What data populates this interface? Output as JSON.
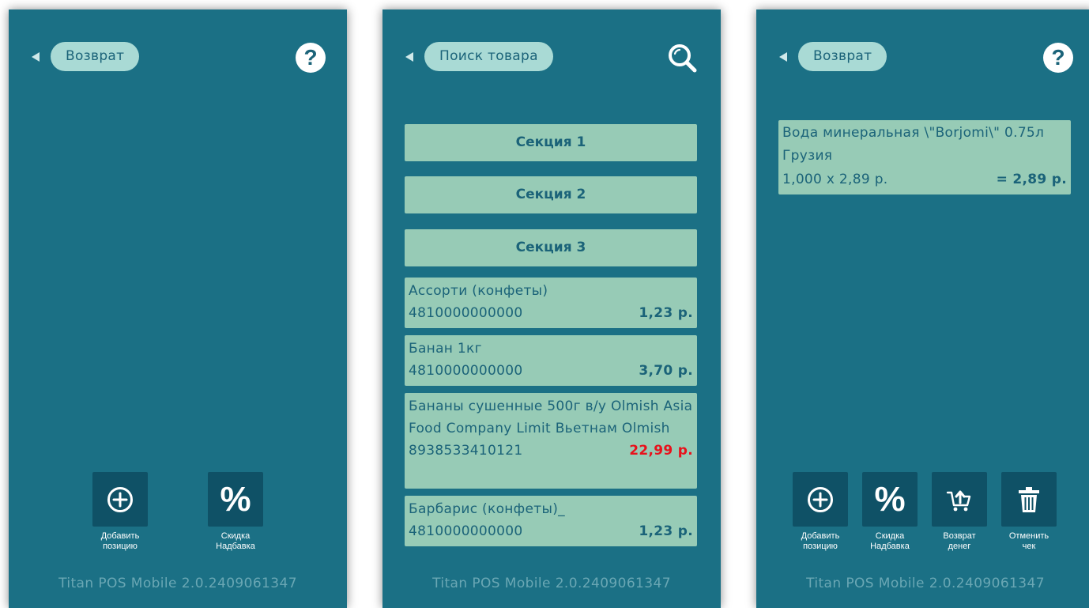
{
  "screen1": {
    "title": "Возврат",
    "help_glyph": "?",
    "actions": [
      {
        "label": "Добавить\nпозицию",
        "icon": "plus-circle-icon"
      },
      {
        "label": "Скидка\nНадбавка",
        "icon": "percent-icon",
        "glyph": "%"
      }
    ],
    "version": "Titan POS Mobile 2.0.2409061347"
  },
  "screen2": {
    "title": "Поиск товара",
    "sections": [
      "Секция 1",
      "Секция 2",
      "Секция 3"
    ],
    "products": [
      {
        "name": "Ассорти (конфеты)",
        "barcode": "4810000000000",
        "price": "1,23 р."
      },
      {
        "name": "Банан 1кг",
        "barcode": "4810000000000",
        "price": "3,70 р."
      },
      {
        "name": "Бананы сушенные 500г в/у Olmish Asia Food Company Limit Вьетнам Olmish",
        "barcode": "8938533410121",
        "price": "22,99 р.",
        "price_color": "#e8111b"
      },
      {
        "name": "Барбарис (конфеты)_",
        "barcode": "4810000000000",
        "price": "1,23 р."
      }
    ],
    "version": "Titan POS Mobile 2.0.2409061347"
  },
  "screen3": {
    "title": "Возврат",
    "help_glyph": "?",
    "receipt_item": {
      "name": "Вода минеральная \\\"Borjomi\\\" 0.75л Грузия",
      "qty_price": "1,000 x 2,89 р.",
      "total": "= 2,89 р."
    },
    "actions": [
      {
        "label": "Добавить\nпозицию",
        "icon": "plus-circle-icon"
      },
      {
        "label": "Скидка\nНадбавка",
        "icon": "percent-icon",
        "glyph": "%"
      },
      {
        "label": "Возврат\nденег",
        "icon": "cart-return-icon"
      },
      {
        "label": "Отменить\nчек",
        "icon": "trash-icon"
      }
    ],
    "version": "Titan POS Mobile 2.0.2409061347"
  },
  "colors": {
    "background": "#1b7085",
    "pill": "#a9dad5",
    "card": "#97cbb6",
    "text": "#1b6379",
    "tile": "#0f5166",
    "accent_red": "#e8111b"
  }
}
